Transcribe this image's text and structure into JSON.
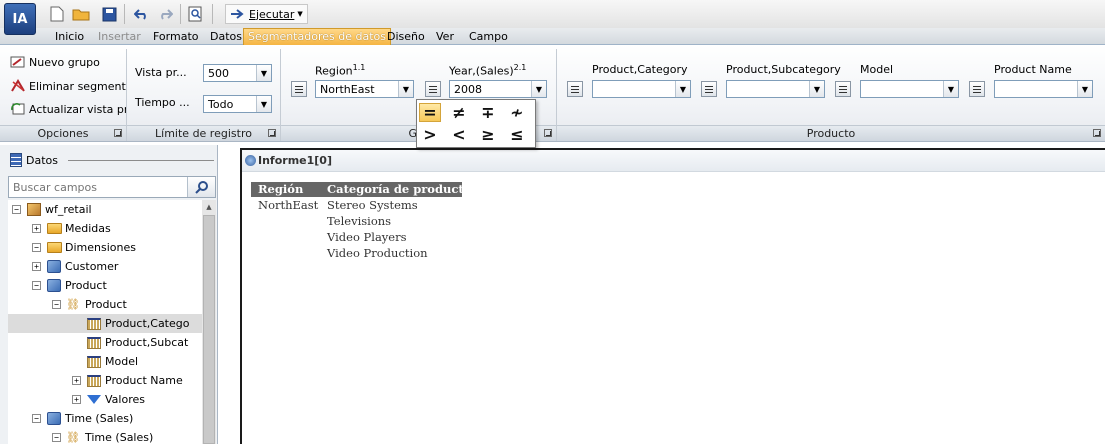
{
  "app": {
    "logo": "IA",
    "run_label": "Ejecutar"
  },
  "tabs": [
    {
      "label": "Inicio",
      "state": "normal"
    },
    {
      "label": "Insertar",
      "state": "disabled"
    },
    {
      "label": "Formato",
      "state": "normal"
    },
    {
      "label": "Datos",
      "state": "normal"
    },
    {
      "label": "Segmentadores de datos",
      "state": "active"
    },
    {
      "label": "Diseño",
      "state": "normal"
    },
    {
      "label": "Ver",
      "state": "normal"
    },
    {
      "label": "Campo",
      "state": "normal"
    }
  ],
  "ribbon": {
    "opciones": {
      "items": [
        "Nuevo grupo",
        "Eliminar segmentac",
        "Actualizar vista pre"
      ],
      "label": "Opciones"
    },
    "limite": {
      "vista_label": "Vista pr...",
      "vista_value": "500",
      "tiempo_label": "Tiempo ...",
      "tiempo_value": "Todo",
      "label": "Límite de registro"
    },
    "grupo": {
      "label": "Gru",
      "region_label": "Region",
      "region_sup": "1.1",
      "region_value": "NorthEast",
      "year_label": "Year,(Sales)",
      "year_sup": "2.1",
      "year_value": "2008"
    },
    "producto": {
      "label": "Producto",
      "fields": [
        {
          "label": "Product,Category",
          "value": ""
        },
        {
          "label": "Product,Subcategory",
          "value": ""
        },
        {
          "label": "Model",
          "value": ""
        },
        {
          "label": "Product Name",
          "value": ""
        }
      ]
    }
  },
  "operators": [
    "=",
    "≠",
    "∓",
    "≁",
    ">",
    "<",
    "≥",
    "≤"
  ],
  "left_panel": {
    "tab_label": "Datos",
    "search_placeholder": "Buscar campos",
    "tree": [
      {
        "label": "wf_retail",
        "icon": "box-icon",
        "exp": "−",
        "level": 0
      },
      {
        "label": "Medidas",
        "icon": "folder-icon",
        "exp": "+",
        "level": 1
      },
      {
        "label": "Dimensiones",
        "icon": "folder-icon",
        "exp": "−",
        "level": 1
      },
      {
        "label": "Customer",
        "icon": "cube-icon",
        "exp": "+",
        "level": 2
      },
      {
        "label": "Product",
        "icon": "cube-icon",
        "exp": "−",
        "level": 2
      },
      {
        "label": "Product",
        "icon": "hierarchy-icon",
        "exp": "−",
        "level": 3
      },
      {
        "label": "Product,Catego",
        "icon": "grid-icon",
        "exp": "",
        "level": 4,
        "selected": true
      },
      {
        "label": "Product,Subcat",
        "icon": "grid-icon",
        "exp": "",
        "level": 4
      },
      {
        "label": "Model",
        "icon": "grid-icon",
        "exp": "",
        "level": 4
      },
      {
        "label": "Product Name",
        "icon": "grid-icon",
        "exp": "+",
        "level": 4
      },
      {
        "label": "Valores",
        "icon": "triangle-icon",
        "exp": "+",
        "level": 4
      },
      {
        "label": "Time (Sales)",
        "icon": "cube-icon",
        "exp": "−",
        "level": 2
      },
      {
        "label": "Time (Sales)",
        "icon": "hierarchy-icon",
        "exp": "−",
        "level": 3
      }
    ]
  },
  "report": {
    "title": "Informe1[0]",
    "headers": [
      "Región",
      "Categoría de producto"
    ],
    "region": "NorthEast",
    "categories": [
      "Stereo Systems",
      "Televisions",
      "Video Players",
      "Video Production"
    ]
  }
}
